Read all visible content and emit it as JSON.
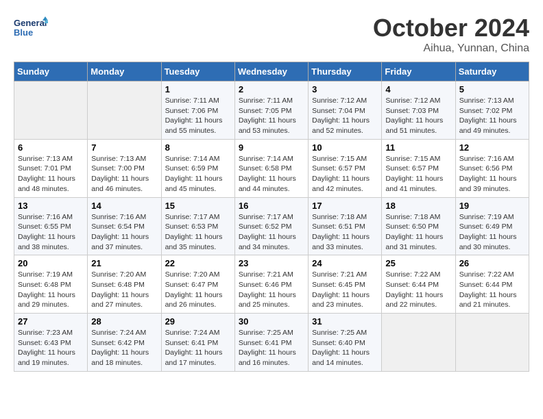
{
  "header": {
    "logo_text_general": "General",
    "logo_text_blue": "Blue",
    "month_title": "October 2024",
    "subtitle": "Aihua, Yunnan, China"
  },
  "days_of_week": [
    "Sunday",
    "Monday",
    "Tuesday",
    "Wednesday",
    "Thursday",
    "Friday",
    "Saturday"
  ],
  "weeks": [
    [
      {
        "day": "",
        "empty": true
      },
      {
        "day": "",
        "empty": true
      },
      {
        "day": "1",
        "sunrise": "Sunrise: 7:11 AM",
        "sunset": "Sunset: 7:06 PM",
        "daylight": "Daylight: 11 hours and 55 minutes."
      },
      {
        "day": "2",
        "sunrise": "Sunrise: 7:11 AM",
        "sunset": "Sunset: 7:05 PM",
        "daylight": "Daylight: 11 hours and 53 minutes."
      },
      {
        "day": "3",
        "sunrise": "Sunrise: 7:12 AM",
        "sunset": "Sunset: 7:04 PM",
        "daylight": "Daylight: 11 hours and 52 minutes."
      },
      {
        "day": "4",
        "sunrise": "Sunrise: 7:12 AM",
        "sunset": "Sunset: 7:03 PM",
        "daylight": "Daylight: 11 hours and 51 minutes."
      },
      {
        "day": "5",
        "sunrise": "Sunrise: 7:13 AM",
        "sunset": "Sunset: 7:02 PM",
        "daylight": "Daylight: 11 hours and 49 minutes."
      }
    ],
    [
      {
        "day": "6",
        "sunrise": "Sunrise: 7:13 AM",
        "sunset": "Sunset: 7:01 PM",
        "daylight": "Daylight: 11 hours and 48 minutes."
      },
      {
        "day": "7",
        "sunrise": "Sunrise: 7:13 AM",
        "sunset": "Sunset: 7:00 PM",
        "daylight": "Daylight: 11 hours and 46 minutes."
      },
      {
        "day": "8",
        "sunrise": "Sunrise: 7:14 AM",
        "sunset": "Sunset: 6:59 PM",
        "daylight": "Daylight: 11 hours and 45 minutes."
      },
      {
        "day": "9",
        "sunrise": "Sunrise: 7:14 AM",
        "sunset": "Sunset: 6:58 PM",
        "daylight": "Daylight: 11 hours and 44 minutes."
      },
      {
        "day": "10",
        "sunrise": "Sunrise: 7:15 AM",
        "sunset": "Sunset: 6:57 PM",
        "daylight": "Daylight: 11 hours and 42 minutes."
      },
      {
        "day": "11",
        "sunrise": "Sunrise: 7:15 AM",
        "sunset": "Sunset: 6:57 PM",
        "daylight": "Daylight: 11 hours and 41 minutes."
      },
      {
        "day": "12",
        "sunrise": "Sunrise: 7:16 AM",
        "sunset": "Sunset: 6:56 PM",
        "daylight": "Daylight: 11 hours and 39 minutes."
      }
    ],
    [
      {
        "day": "13",
        "sunrise": "Sunrise: 7:16 AM",
        "sunset": "Sunset: 6:55 PM",
        "daylight": "Daylight: 11 hours and 38 minutes."
      },
      {
        "day": "14",
        "sunrise": "Sunrise: 7:16 AM",
        "sunset": "Sunset: 6:54 PM",
        "daylight": "Daylight: 11 hours and 37 minutes."
      },
      {
        "day": "15",
        "sunrise": "Sunrise: 7:17 AM",
        "sunset": "Sunset: 6:53 PM",
        "daylight": "Daylight: 11 hours and 35 minutes."
      },
      {
        "day": "16",
        "sunrise": "Sunrise: 7:17 AM",
        "sunset": "Sunset: 6:52 PM",
        "daylight": "Daylight: 11 hours and 34 minutes."
      },
      {
        "day": "17",
        "sunrise": "Sunrise: 7:18 AM",
        "sunset": "Sunset: 6:51 PM",
        "daylight": "Daylight: 11 hours and 33 minutes."
      },
      {
        "day": "18",
        "sunrise": "Sunrise: 7:18 AM",
        "sunset": "Sunset: 6:50 PM",
        "daylight": "Daylight: 11 hours and 31 minutes."
      },
      {
        "day": "19",
        "sunrise": "Sunrise: 7:19 AM",
        "sunset": "Sunset: 6:49 PM",
        "daylight": "Daylight: 11 hours and 30 minutes."
      }
    ],
    [
      {
        "day": "20",
        "sunrise": "Sunrise: 7:19 AM",
        "sunset": "Sunset: 6:48 PM",
        "daylight": "Daylight: 11 hours and 29 minutes."
      },
      {
        "day": "21",
        "sunrise": "Sunrise: 7:20 AM",
        "sunset": "Sunset: 6:48 PM",
        "daylight": "Daylight: 11 hours and 27 minutes."
      },
      {
        "day": "22",
        "sunrise": "Sunrise: 7:20 AM",
        "sunset": "Sunset: 6:47 PM",
        "daylight": "Daylight: 11 hours and 26 minutes."
      },
      {
        "day": "23",
        "sunrise": "Sunrise: 7:21 AM",
        "sunset": "Sunset: 6:46 PM",
        "daylight": "Daylight: 11 hours and 25 minutes."
      },
      {
        "day": "24",
        "sunrise": "Sunrise: 7:21 AM",
        "sunset": "Sunset: 6:45 PM",
        "daylight": "Daylight: 11 hours and 23 minutes."
      },
      {
        "day": "25",
        "sunrise": "Sunrise: 7:22 AM",
        "sunset": "Sunset: 6:44 PM",
        "daylight": "Daylight: 11 hours and 22 minutes."
      },
      {
        "day": "26",
        "sunrise": "Sunrise: 7:22 AM",
        "sunset": "Sunset: 6:44 PM",
        "daylight": "Daylight: 11 hours and 21 minutes."
      }
    ],
    [
      {
        "day": "27",
        "sunrise": "Sunrise: 7:23 AM",
        "sunset": "Sunset: 6:43 PM",
        "daylight": "Daylight: 11 hours and 19 minutes."
      },
      {
        "day": "28",
        "sunrise": "Sunrise: 7:24 AM",
        "sunset": "Sunset: 6:42 PM",
        "daylight": "Daylight: 11 hours and 18 minutes."
      },
      {
        "day": "29",
        "sunrise": "Sunrise: 7:24 AM",
        "sunset": "Sunset: 6:41 PM",
        "daylight": "Daylight: 11 hours and 17 minutes."
      },
      {
        "day": "30",
        "sunrise": "Sunrise: 7:25 AM",
        "sunset": "Sunset: 6:41 PM",
        "daylight": "Daylight: 11 hours and 16 minutes."
      },
      {
        "day": "31",
        "sunrise": "Sunrise: 7:25 AM",
        "sunset": "Sunset: 6:40 PM",
        "daylight": "Daylight: 11 hours and 14 minutes."
      },
      {
        "day": "",
        "empty": true
      },
      {
        "day": "",
        "empty": true
      }
    ]
  ]
}
